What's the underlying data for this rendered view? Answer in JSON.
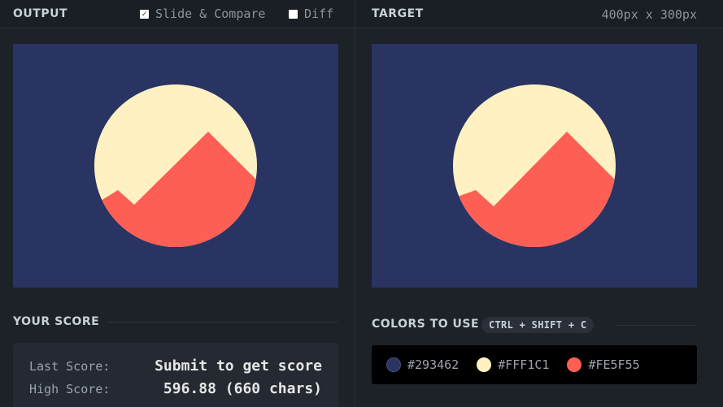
{
  "output": {
    "title": "OUTPUT",
    "slide_compare_label": "Slide & Compare",
    "slide_compare_checked": true,
    "diff_label": "Diff",
    "diff_checked": false
  },
  "target": {
    "title": "TARGET",
    "dimensions": "400px x 300px"
  },
  "score": {
    "title": "YOUR SCORE",
    "last_label": "Last Score:",
    "last_value": "Submit to get score",
    "high_label": "High Score:",
    "high_value": "596.88 (660 chars)"
  },
  "colors": {
    "title": "COLORS TO USE",
    "shortcut": "CTRL + SHIFT + C",
    "swatches": [
      {
        "hex": "#293462",
        "label": "#293462"
      },
      {
        "hex": "#FFF1C1",
        "label": "#FFF1C1"
      },
      {
        "hex": "#FE5F55",
        "label": "#FE5F55"
      }
    ]
  },
  "icons": {
    "checkbox_checked": "check-icon"
  }
}
